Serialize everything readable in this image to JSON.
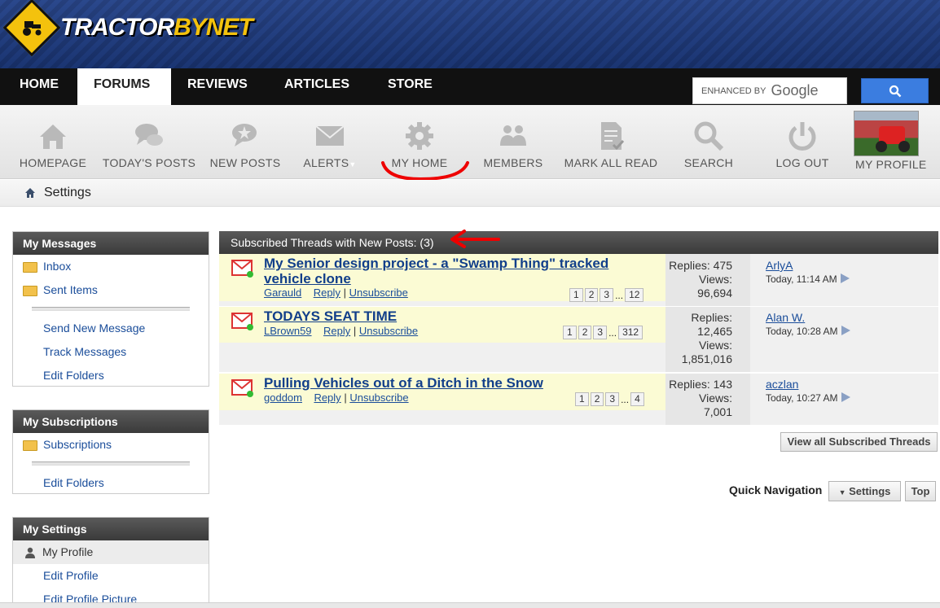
{
  "site": {
    "logo_main": "TRACTOR",
    "logo_accent": "BYNET",
    "brand_color": "#f4c20d"
  },
  "topnav": {
    "tabs": [
      {
        "label": "HOME",
        "active": false
      },
      {
        "label": "FORUMS",
        "active": true
      },
      {
        "label": "REVIEWS",
        "active": false
      },
      {
        "label": "ARTICLES",
        "active": false
      },
      {
        "label": "STORE",
        "active": false
      }
    ],
    "search": {
      "prefix": "ENHANCED BY",
      "provider": "Google",
      "button_icon": "search-icon"
    }
  },
  "toolbar": {
    "items": [
      {
        "label": "HOMEPAGE",
        "icon": "house-icon"
      },
      {
        "label": "TODAY'S POSTS",
        "icon": "speech-bubbles-icon"
      },
      {
        "label": "NEW POSTS",
        "icon": "star-bubble-icon"
      },
      {
        "label": "ALERTS",
        "icon": "envelope-icon"
      },
      {
        "label": "MY HOME",
        "icon": "gear-icon"
      },
      {
        "label": "MEMBERS",
        "icon": "people-icon"
      },
      {
        "label": "MARK ALL READ",
        "icon": "document-check-icon"
      },
      {
        "label": "SEARCH",
        "icon": "magnifier-icon"
      },
      {
        "label": "LOG OUT",
        "icon": "power-icon"
      }
    ],
    "profile_label": "MY PROFILE"
  },
  "breadcrumb": {
    "title": "Settings"
  },
  "sidebar": {
    "messages": {
      "title": "My Messages",
      "folders": [
        "Inbox",
        "Sent Items"
      ],
      "links": [
        "Send New Message",
        "Track Messages",
        "Edit Folders"
      ]
    },
    "subscriptions": {
      "title": "My Subscriptions",
      "folders": [
        "Subscriptions"
      ],
      "links": [
        "Edit Folders"
      ]
    },
    "settings": {
      "title": "My Settings",
      "profile": "My Profile",
      "links": [
        "Edit Profile",
        "Edit Profile Picture"
      ]
    }
  },
  "main": {
    "header": "Subscribed Threads with New Posts: (3)",
    "threads": [
      {
        "title": "My Senior design project - a \"Swamp Thing\" tracked vehicle clone",
        "author": "Garauld",
        "reply": "Reply",
        "unsubscribe": "Unsubscribe",
        "pages": [
          "1",
          "2",
          "3",
          "12"
        ],
        "replies_label": "Replies: 475",
        "views_label": "Views:",
        "views": "96,694",
        "last_user": "ArlyA",
        "last_time": "Today, 11:14 AM"
      },
      {
        "title": "TODAYS SEAT TIME",
        "author": "LBrown59",
        "reply": "Reply",
        "unsubscribe": "Unsubscribe",
        "pages": [
          "1",
          "2",
          "3",
          "312"
        ],
        "replies_label": "Replies:",
        "replies": "12,465",
        "views_label": "Views:",
        "views": "1,851,016",
        "last_user": "Alan W.",
        "last_time": "Today, 10:28 AM"
      },
      {
        "title": "Pulling Vehicles out of a Ditch in the Snow",
        "author": "goddom",
        "reply": "Reply",
        "unsubscribe": "Unsubscribe",
        "pages": [
          "1",
          "2",
          "3",
          "4"
        ],
        "replies_label": "Replies: 143",
        "views_label": "Views:",
        "views": "7,001",
        "last_user": "aczlan",
        "last_time": "Today, 10:27 AM"
      }
    ],
    "ellipsis": "...",
    "sep": "|",
    "view_all": "View all Subscribed Threads",
    "quick_nav": {
      "label": "Quick Navigation",
      "select": "Settings",
      "top": "Top"
    }
  }
}
